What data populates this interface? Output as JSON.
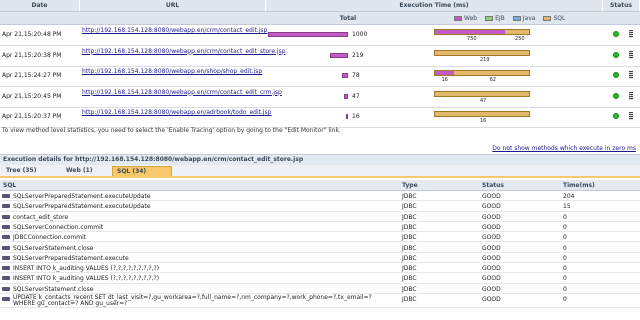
{
  "headers": {
    "date": "Date",
    "url": "URL",
    "exec_time": "Execution Time (ms)",
    "total": "Total",
    "status": "Status",
    "legend": [
      {
        "label": "Web",
        "color": "#c35bc4"
      },
      {
        "label": "EJB",
        "color": "#8bcf7a"
      },
      {
        "label": "Java",
        "color": "#7aa9e0"
      },
      {
        "label": "SQL",
        "color": "#e4b86a"
      }
    ]
  },
  "traces": [
    {
      "date": "Apr 21,15:20:48 PM",
      "url": "http://192.168.154.128:8080/webapp.en/crm/contact_edit.jsp",
      "total": "1000",
      "total_frac": 1.0,
      "web_frac": 0.73,
      "web_label": "750",
      "sql_label": "250"
    },
    {
      "date": "Apr 21,15:20:38 PM",
      "url": "http://192.168.154.128:8080/webapp.en/crm/contact_edit_store.jsp",
      "total": "219",
      "total_frac": 0.219,
      "web_frac": 0.0,
      "web_label": "",
      "sql_label": "219"
    },
    {
      "date": "Apr 21,15:24:27 PM",
      "url": "http://192.168.154.128:8080/webapp.en/shop/shop_edit.jsp",
      "total": "78",
      "total_frac": 0.078,
      "web_frac": 0.2,
      "web_label": "16",
      "sql_label": "62"
    },
    {
      "date": "Apr 21,15:20:45 PM",
      "url": "http://192.168.154.128:8080/webapp.en/crm/contact_edit_crm.jsp",
      "total": "47",
      "total_frac": 0.047,
      "web_frac": 0.0,
      "web_label": "",
      "sql_label": "47"
    },
    {
      "date": "Apr 21,15:20:37 PM",
      "url": "http://192.168.154.128:8080/webapp.en/adrbook/todo_edit.jsp",
      "total": "16",
      "total_frac": 0.016,
      "web_frac": 0.0,
      "web_label": "",
      "sql_label": "16"
    }
  ],
  "note": "To view method level statistics, you need to select the 'Enable Tracing' option by going to the \"Edit Monitor\" link.",
  "dont_show": "Do not show methods which execute in zero ms",
  "details_title": "Execution details for http://192.168.154.128:8080/webapp.en/crm/contact_edit_store.jsp",
  "tabs": [
    {
      "label": "Tree (35)"
    },
    {
      "label": "Web (1)"
    },
    {
      "label": "SQL (34)"
    }
  ],
  "sql_headers": {
    "sql": "SQL",
    "type": "Type",
    "status": "Status",
    "time": "Time(ms)"
  },
  "sql_rows": [
    {
      "stmt": "SQLServerPreparedStatement.executeUpdate",
      "type": "JDBC",
      "status": "GOOD",
      "time": "204"
    },
    {
      "stmt": "SQLServerPreparedStatement.executeUpdate",
      "type": "JDBC",
      "status": "GOOD",
      "time": "15"
    },
    {
      "stmt": "contact_edit_store",
      "type": "JDBC",
      "status": "GOOD",
      "time": "0"
    },
    {
      "stmt": "SQLServerConnection.commit",
      "type": "JDBC",
      "status": "GOOD",
      "time": "0"
    },
    {
      "stmt": "JDBCConnection.commit",
      "type": "JDBC",
      "status": "GOOD",
      "time": "0"
    },
    {
      "stmt": "SQLServerStatement.close",
      "type": "JDBC",
      "status": "GOOD",
      "time": "0"
    },
    {
      "stmt": "SQLServerPreparedStatement.execute",
      "type": "JDBC",
      "status": "GOOD",
      "time": "0"
    },
    {
      "stmt": "INSERT INTO k_auditing VALUES (?,?,?,?,?,?,?,?,?)",
      "type": "JDBC",
      "status": "GOOD",
      "time": "0"
    },
    {
      "stmt": "INSERT INTO k_auditing VALUES (?,?,?,?,?,?,?,?,?)",
      "type": "JDBC",
      "status": "GOOD",
      "time": "0"
    },
    {
      "stmt": "SQLServerStatement.close",
      "type": "JDBC",
      "status": "GOOD",
      "time": "0"
    },
    {
      "stmt": "UPDATE k_contacts_recent SET dt_last_visit=?,gu_workarea=?,full_name=?,nm_company=?,work_phone=?,tx_email=? WHERE gu_contact=? AND gu_user=?",
      "type": "JDBC",
      "status": "GOOD",
      "time": "0"
    }
  ]
}
